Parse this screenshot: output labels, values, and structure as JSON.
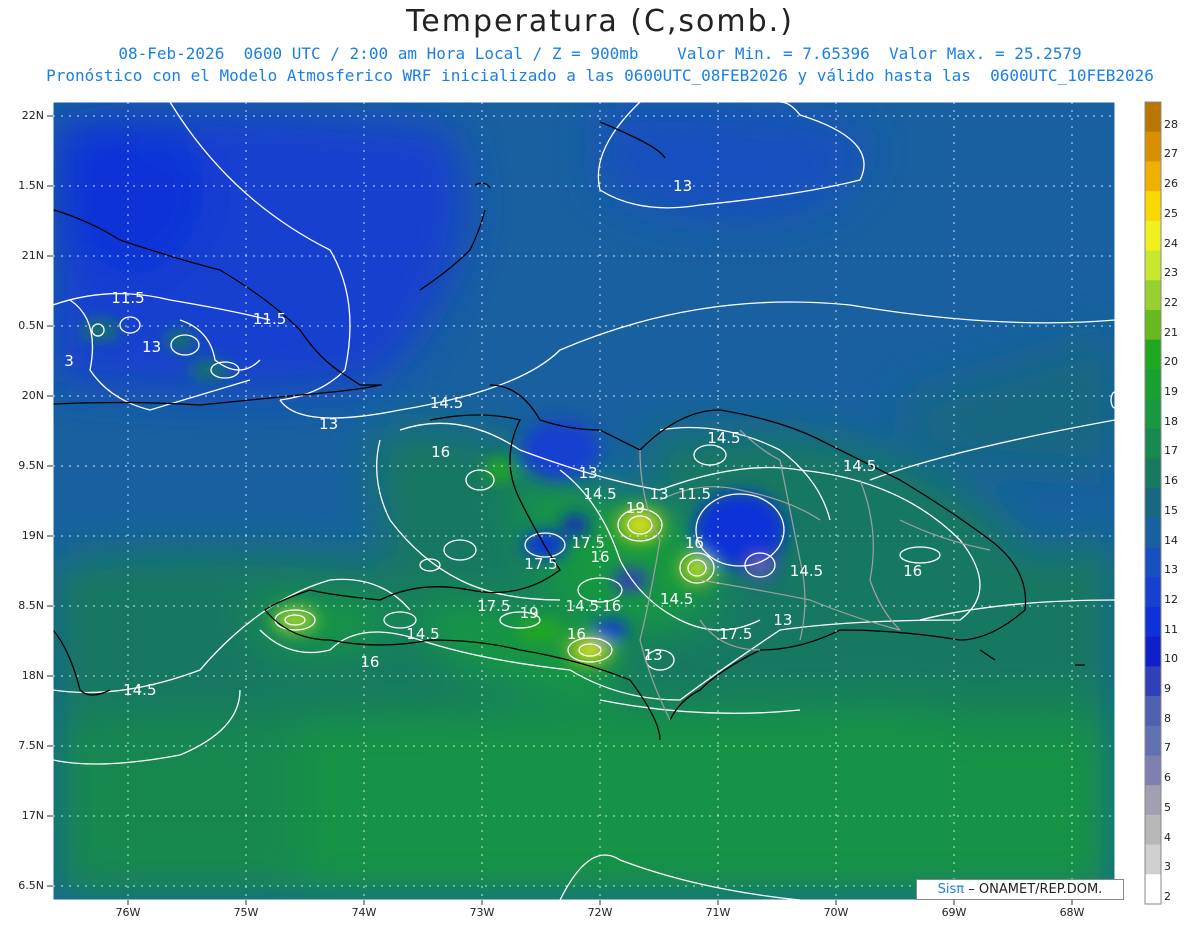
{
  "header": {
    "title": "Temperatura (C,somb.)",
    "line1": "08-Feb-2026  0600 UTC / 2:00 am Hora Local / Z = 900mb    Valor Min. = 7.65396  Valor Max. = 25.2579",
    "line2": "Pronóstico con el Modelo Atmosferico WRF inicializado a las 0600UTC_08FEB2026 y válido hasta las  0600UTC_10FEB2026"
  },
  "axes": {
    "lat_labels": [
      "22N",
      "1.5N",
      "21N",
      "0.5N",
      "20N",
      "9.5N",
      "19N",
      "8.5N",
      "18N",
      "7.5N",
      "17N",
      "6.5N"
    ],
    "lon_labels": [
      "76W",
      "75W",
      "74W",
      "73W",
      "72W",
      "71W",
      "70W",
      "69W",
      "68W"
    ]
  },
  "colorbar": {
    "labels": [
      "28",
      "27",
      "26",
      "25",
      "24",
      "23",
      "22",
      "21",
      "20",
      "19",
      "18",
      "17",
      "16",
      "15",
      "14",
      "13",
      "12",
      "11",
      "10",
      "9",
      "8",
      "7",
      "6",
      "5",
      "4",
      "3",
      "2"
    ],
    "colors": [
      "#b87800",
      "#d89000",
      "#f0b000",
      "#f8d800",
      "#f0f020",
      "#c8e830",
      "#98d030",
      "#68b820",
      "#20a820",
      "#18a030",
      "#189840",
      "#188850",
      "#187860",
      "#186880",
      "#1860a0",
      "#1850c0",
      "#1840d0",
      "#1030d8",
      "#1020c8",
      "#3040b8",
      "#5060b0",
      "#6070b0",
      "#8080b0",
      "#a0a0b0",
      "#b8b8b8",
      "#d0d0d0",
      "#ffffff"
    ]
  },
  "contour_labels": [
    {
      "text": "13",
      "lon": -71.3,
      "lat": 21.5
    },
    {
      "text": "11.5",
      "lon": -76.0,
      "lat": 20.7
    },
    {
      "text": "11.5",
      "lon": -74.8,
      "lat": 20.55
    },
    {
      "text": "13",
      "lon": -75.8,
      "lat": 20.35
    },
    {
      "text": "13",
      "lon": -74.3,
      "lat": 19.8
    },
    {
      "text": "14.5",
      "lon": -73.3,
      "lat": 19.95
    },
    {
      "text": "16",
      "lon": -73.35,
      "lat": 19.6
    },
    {
      "text": "13",
      "lon": -72.1,
      "lat": 19.45
    },
    {
      "text": "14.5",
      "lon": -72.0,
      "lat": 19.3
    },
    {
      "text": "19",
      "lon": -71.7,
      "lat": 19.2
    },
    {
      "text": "13",
      "lon": -71.5,
      "lat": 19.3
    },
    {
      "text": "11.5",
      "lon": -71.2,
      "lat": 19.3
    },
    {
      "text": "14.5",
      "lon": -70.95,
      "lat": 19.7
    },
    {
      "text": "14.5",
      "lon": -69.8,
      "lat": 19.5
    },
    {
      "text": "17.5",
      "lon": -72.1,
      "lat": 18.95
    },
    {
      "text": "17.5",
      "lon": -72.5,
      "lat": 18.8
    },
    {
      "text": "16",
      "lon": -72.0,
      "lat": 18.85
    },
    {
      "text": "16",
      "lon": -71.2,
      "lat": 18.95
    },
    {
      "text": "14.5",
      "lon": -70.25,
      "lat": 18.75
    },
    {
      "text": "16",
      "lon": -69.35,
      "lat": 18.75
    },
    {
      "text": "14.5",
      "lon": -71.35,
      "lat": 18.55
    },
    {
      "text": "14.5",
      "lon": -72.15,
      "lat": 18.5
    },
    {
      "text": "16",
      "lon": -71.9,
      "lat": 18.5
    },
    {
      "text": "17.5",
      "lon": -72.9,
      "lat": 18.5
    },
    {
      "text": "19",
      "lon": -72.6,
      "lat": 18.45
    },
    {
      "text": "16",
      "lon": -72.2,
      "lat": 18.3
    },
    {
      "text": "13",
      "lon": -70.45,
      "lat": 18.4
    },
    {
      "text": "17.5",
      "lon": -70.85,
      "lat": 18.3
    },
    {
      "text": "13",
      "lon": -71.55,
      "lat": 18.15
    },
    {
      "text": "14.5",
      "lon": -73.5,
      "lat": 18.3
    },
    {
      "text": "16",
      "lon": -73.95,
      "lat": 18.1
    },
    {
      "text": "14.5",
      "lon": -75.9,
      "lat": 17.9
    },
    {
      "text": "3",
      "lon": -76.5,
      "lat": 20.25
    }
  ],
  "credit": {
    "logo": "Sisπ",
    "text": "– ONAMET/REP.DOM."
  }
}
